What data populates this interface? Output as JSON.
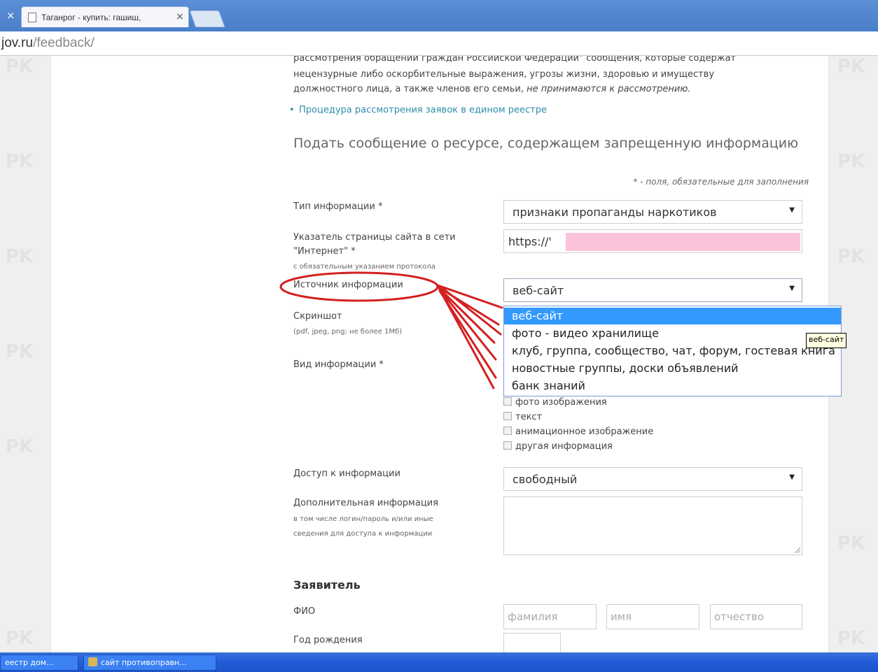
{
  "browser": {
    "tab_title": "Таганрог - купить: гашиш,",
    "tab_close": "×",
    "window_close": "×",
    "url_host": "jov.ru",
    "url_path": "/feedback/"
  },
  "page": {
    "watermark": "PK",
    "intro_line1": "рассмотрения обращений граждан Российской Федерации\" сообщения, которые содержат",
    "intro_line2": "нецензурные либо оскорбительные выражения, угрозы жизни, здоровью и имуществу",
    "intro_line3_normal": "должностного лица, а также членов его семьи,",
    "intro_line3_italic": "не принимаются к рассмотрению.",
    "procedure_link": "Процедура рассмотрения заявок в едином реестре",
    "section_title": "Подать сообщение о ресурсе, содержащем запрещенную информацию",
    "required_note": "* - поля, обязательные для заполнения"
  },
  "form": {
    "info_type_label": "Тип информации *",
    "info_type_value": "признаки пропаганды наркотиков",
    "url_label_line1": "Указатель страницы сайта в сети",
    "url_label_line2": "\"Интернет\" *",
    "url_hint": "с обязательным указанием протокола",
    "url_value": "https://'",
    "source_label": "Источник информации",
    "source_value": "веб-сайт",
    "source_options": [
      "веб-сайт",
      "фото - видео хранилище",
      "клуб, группа, сообщество, чат, форум, гостевая книга",
      "новостные группы, доски объявлений",
      "банк знаний"
    ],
    "tooltip": "веб-сайт",
    "screenshot_label": "Скриншот",
    "screenshot_hint": "(pdf, jpeg, png; не более 1Мб)",
    "kind_label": "Вид информации *",
    "kind_options": [
      "фото изображения",
      "текст",
      "анимационное изображение",
      "другая информация"
    ],
    "access_label": "Доступ к информации",
    "access_value": "свободный",
    "extra_label": "Дополнительная информация",
    "extra_hint_line1": "в том числе логин/пароль и/или иные",
    "extra_hint_line2": "сведения для доступа к информации",
    "select_arrow": "▼"
  },
  "applicant": {
    "heading": "Заявитель",
    "fio_label": "ФИО",
    "surname_placeholder": "фамилия",
    "name_placeholder": "имя",
    "patronymic_placeholder": "отчество",
    "birth_year_label": "Год рождения"
  },
  "taskbar": {
    "item1": "еестр дом...",
    "item2": "сайт противоправн..."
  },
  "colors": {
    "link": "#2f8ea8",
    "selection": "#3399ff",
    "annotation": "#d42020",
    "redacted": "#fbc3da"
  }
}
